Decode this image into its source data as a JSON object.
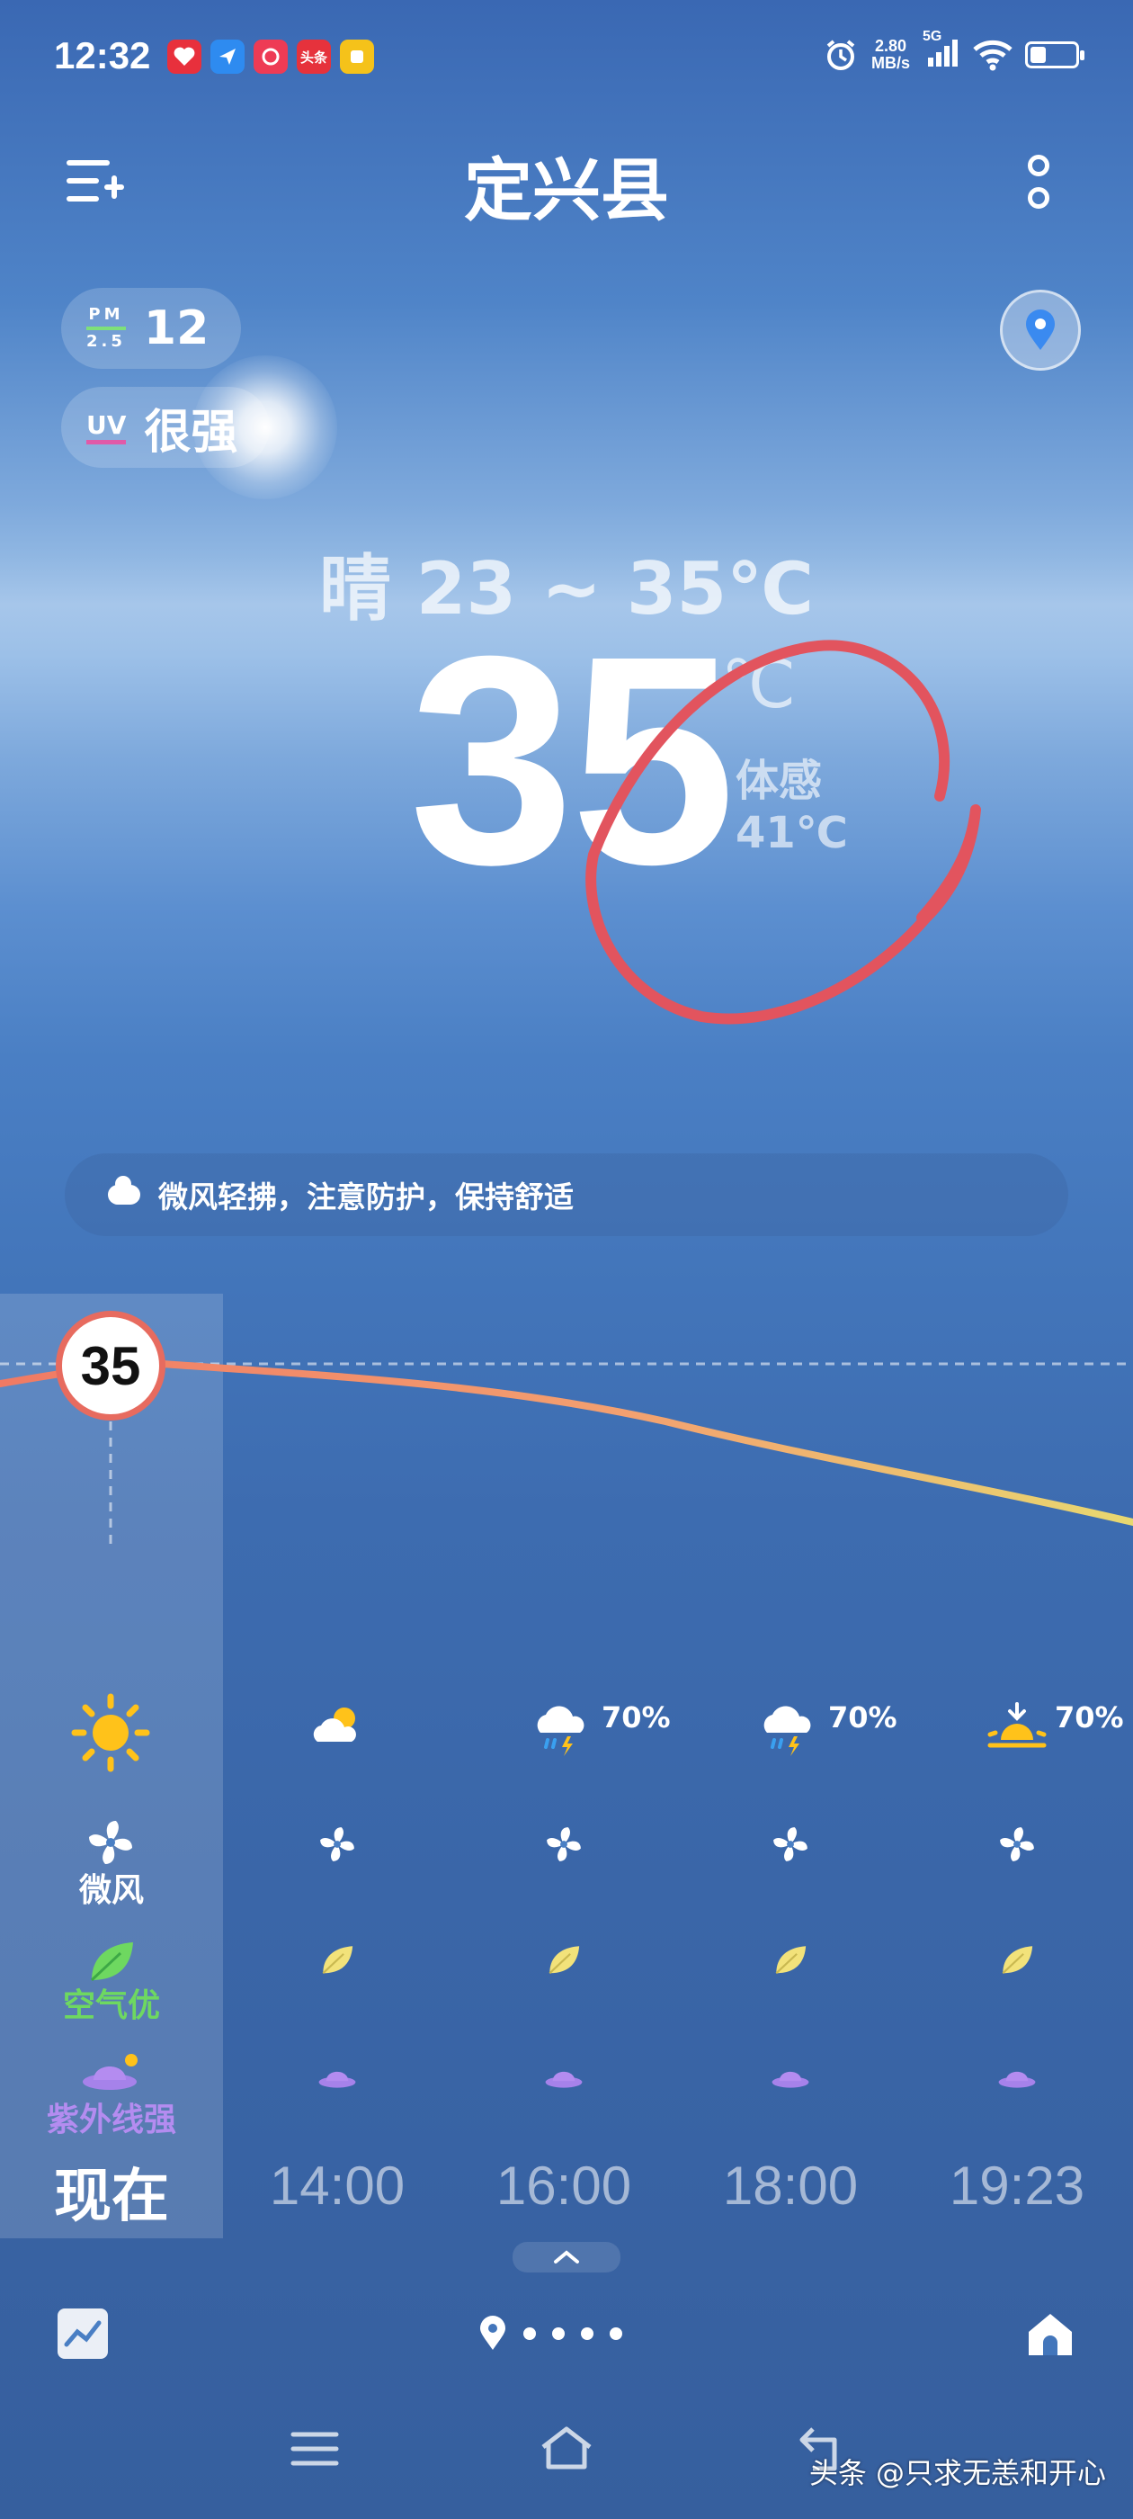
{
  "status_bar": {
    "time": "12:32",
    "net_speed_value": "2.80",
    "net_speed_unit": "MB/s",
    "network": "5G",
    "app_badges": [
      {
        "label": "",
        "color": "#e8303c"
      },
      {
        "label": "",
        "color": "#2e8bf0"
      },
      {
        "label": "",
        "color": "#ee3b55"
      },
      {
        "label": "头条",
        "color": "#e6323c"
      },
      {
        "label": "",
        "color": "#f5c21a"
      }
    ],
    "battery_level": 0.35
  },
  "header": {
    "city": "定兴县",
    "menu_icon": "menu-add-icon",
    "more_icon": "more-icon"
  },
  "chips": {
    "pm_label_top": "PM",
    "pm_label_bottom": "2.5",
    "pm_value": "12",
    "uv_label": "UV",
    "uv_value": "很强"
  },
  "current": {
    "condition_range": "晴 23 ~ 35℃",
    "temperature": "35",
    "unit": "℃",
    "feels_label": "体感",
    "feels_value": "41℃"
  },
  "tip": "微风轻拂，注意防护，保持舒适",
  "hourly": {
    "now_temp": "35",
    "now_labels": {
      "wind": "微风",
      "air": "空气优",
      "uv": "紫外线强",
      "time": "现在"
    },
    "slots": [
      {
        "time": "14:00",
        "weather_icon": "partly-cloudy-icon",
        "precip": ""
      },
      {
        "time": "16:00",
        "weather_icon": "thunder-rain-icon",
        "precip": "70%"
      },
      {
        "time": "18:00",
        "weather_icon": "thunder-rain-icon",
        "precip": "70%"
      },
      {
        "time": "19:23",
        "weather_icon": "sunset-icon",
        "precip": "70%"
      }
    ]
  },
  "colors": {
    "annotation_red": "#e2545e",
    "temp_curve_start": "#f08060",
    "temp_curve_end": "#e8d870",
    "air_good": "#6ed860",
    "uv_purple": "#b48cf0"
  },
  "bottom": {
    "pager_pages": 5,
    "pager_active": 0
  },
  "watermark": "头条 @只求无恙和开心"
}
